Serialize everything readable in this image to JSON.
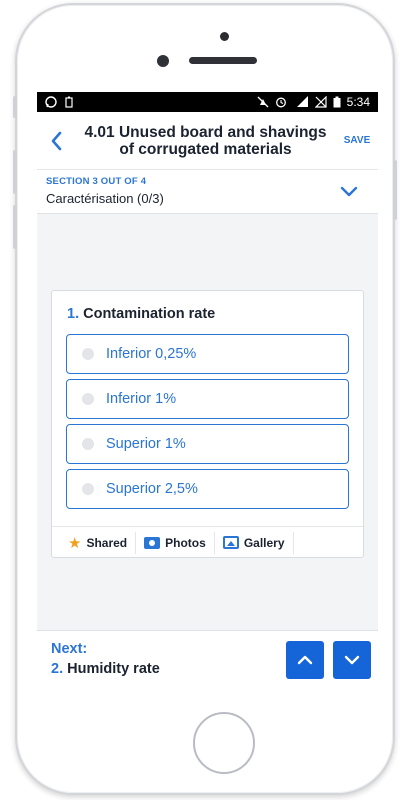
{
  "statusbar": {
    "icons_left": [
      "whatsapp-icon",
      "battery-saver-icon"
    ],
    "icons_right": [
      "mute-icon",
      "alarm-icon",
      "signal-4g-icon",
      "no-signal-icon",
      "battery-icon"
    ],
    "network": "4G",
    "time": "5:34"
  },
  "appbar": {
    "back_icon": "chevron-left-icon",
    "title": "4.01 Unused board and shavings of corrugated materials",
    "save_label": "SAVE"
  },
  "section": {
    "meta": "SECTION 3 OUT OF 4",
    "title": "Caractérisation (0/3)",
    "chevron_icon": "chevron-down-icon"
  },
  "question": {
    "number": "1.",
    "text": "Contamination rate",
    "options": [
      {
        "label": "Inferior 0,25%",
        "selected": false
      },
      {
        "label": "Inferior 1%",
        "selected": false
      },
      {
        "label": "Superior 1%",
        "selected": false
      },
      {
        "label": "Superior 2,5%",
        "selected": false
      }
    ],
    "footer": {
      "shared_label": "Shared",
      "photos_label": "Photos",
      "gallery_label": "Gallery"
    }
  },
  "next": {
    "label": "Next:",
    "number": "2.",
    "question": "Humidity rate"
  },
  "colors": {
    "accent": "#2b75d4",
    "nav_button": "#1565d8",
    "star": "#f0a020"
  }
}
